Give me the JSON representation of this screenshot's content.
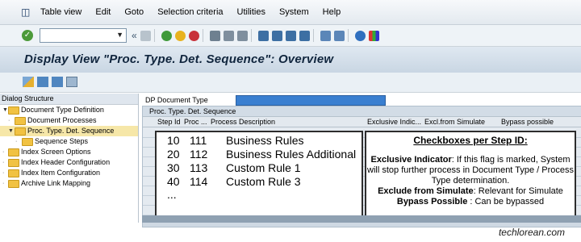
{
  "menubar": {
    "items": [
      "Table view",
      "Edit",
      "Goto",
      "Selection criteria",
      "Utilities",
      "System",
      "Help"
    ]
  },
  "toolbar": {
    "command_field_value": "",
    "icons": [
      "enter-icon",
      "back-icon",
      "exit-icon",
      "cancel-icon",
      "print-icon",
      "find-icon",
      "find-next-icon",
      "first-page-icon",
      "previous-page-icon",
      "next-page-icon",
      "last-page-icon",
      "create-session-icon",
      "shortcut-icon",
      "help-icon",
      "layout-icon"
    ]
  },
  "title": "Display View \"Proc. Type. Det. Sequence\": Overview",
  "tree": {
    "header": "Dialog Structure",
    "items": [
      {
        "label": "Document Type Definition"
      },
      {
        "label": "Document Processes"
      },
      {
        "label": "Proc. Type. Det. Sequence"
      },
      {
        "label": "Sequence Steps"
      },
      {
        "label": "Index Screen Options"
      },
      {
        "label": "Index Header Configuration"
      },
      {
        "label": "Index Item Configuration"
      },
      {
        "label": "Archive Link Mapping"
      }
    ]
  },
  "form": {
    "dp_label": "DP Document Type",
    "dp_value": ""
  },
  "grid": {
    "title": "Proc. Type. Det. Sequence",
    "columns": [
      "Step Id",
      "Proc ...",
      "Process Description",
      "Exclusive Indic...",
      "Excl.from Simulate",
      "Bypass possible"
    ],
    "rows": [
      {
        "step": "10",
        "proc": "111",
        "desc": "Business Rules"
      },
      {
        "step": "20",
        "proc": "112",
        "desc": "Business Rules Additional"
      },
      {
        "step": "30",
        "proc": "113",
        "desc": "Custom Rule 1"
      },
      {
        "step": "40",
        "proc": "114",
        "desc": "Custom Rule 3"
      }
    ],
    "ellipsis": "..."
  },
  "annotation": {
    "heading": "Checkboxes per Step ID:",
    "exclusive_label": "Exclusive Indicator",
    "exclusive_text": ": If this flag is marked, System will stop further process in Document Type / Process Type determination.",
    "simulate_label": "Exclude from Simulate",
    "simulate_text": ": Relevant for Simulate",
    "bypass_label": "Bypass Possible",
    "bypass_text": " : Can be bypassed"
  },
  "watermark": "techlorean.com",
  "colors": {
    "title_band": "#c9d6e3",
    "selected_row": "#f6e7a8",
    "dp_field": "#3a7fd0",
    "folder": "#f1c242"
  }
}
